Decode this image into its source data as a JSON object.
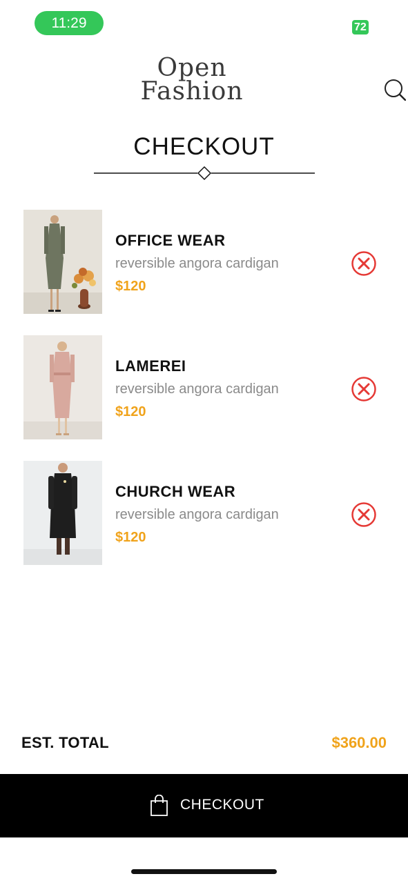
{
  "status_bar": {
    "time": "11:29",
    "battery": "72"
  },
  "header": {
    "logo_line1": "Open",
    "logo_line2": "Fashion"
  },
  "page": {
    "title": "CHECKOUT"
  },
  "cart": {
    "items": [
      {
        "name": "OFFICE WEAR",
        "description": "reversible angora cardigan",
        "price": "$120"
      },
      {
        "name": "LAMEREI",
        "description": "reversible angora cardigan",
        "price": "$120"
      },
      {
        "name": "CHURCH WEAR",
        "description": "reversible angora cardigan",
        "price": "$120"
      }
    ]
  },
  "summary": {
    "total_label": "EST. TOTAL",
    "total_value": "$360.00"
  },
  "cta": {
    "label": "CHECKOUT"
  },
  "colors": {
    "accent": "#f0a31b",
    "status_green": "#34c759",
    "remove_red": "#e53935",
    "cta_bg": "#000000"
  },
  "icons": {
    "search": "search-icon",
    "remove": "remove-icon",
    "bag": "shopping-bag-icon"
  }
}
